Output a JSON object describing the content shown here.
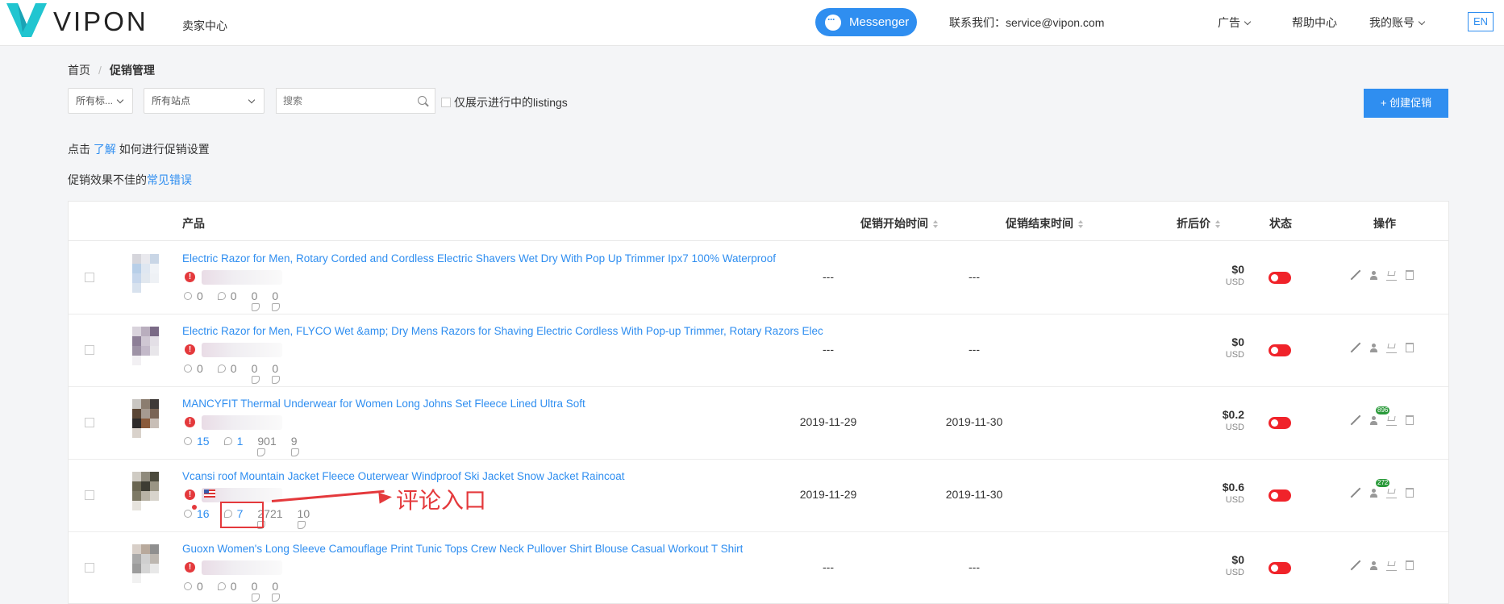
{
  "header": {
    "brand": "VIPON",
    "brand_sub": "卖家中心",
    "messenger_label": "Messenger",
    "contact": "联系我们：service@vipon.com",
    "nav": [
      "广告",
      "帮助中心",
      "我的账号"
    ],
    "lang": "EN",
    "colors": {
      "accent": "#2f8ef0",
      "logo": "#21c5d0"
    }
  },
  "breadcrumb": {
    "home": "首页",
    "current": "促销管理"
  },
  "filters": {
    "all_tags": "所有标...",
    "all_sites": "所有站点",
    "search_placeholder": "搜索",
    "only_active_label": "仅展示进行中的listings",
    "create_button": "+ 创建促销"
  },
  "tips": {
    "line1_prefix": "点击",
    "line1_link": "了解",
    "line1_suffix": "如何进行促销设置",
    "line2_prefix": "促销效果不佳的",
    "line2_link": "常见错误"
  },
  "table": {
    "headers": {
      "product": "产品",
      "start": "促销开始时间",
      "end": "促销结束时间",
      "price": "折后价",
      "status": "状态",
      "actions": "操作"
    },
    "rows": [
      {
        "title": "Electric Razor for Men, Rotary Corded and Cordless Electric Shavers Wet Dry With Pop Up Trimmer Ipx7 100% Waterproof",
        "s1": "0",
        "s2": "0",
        "s3": "0",
        "s4": "0",
        "start": "---",
        "end": "---",
        "price": "$0",
        "currency": "USD",
        "badge": ""
      },
      {
        "title": "Electric Razor for Men, FLYCO Wet &amp; Dry Mens Razors for Shaving Electric Cordless With Pop-up Trimmer, Rotary Razors Elec",
        "s1": "0",
        "s2": "0",
        "s3": "0",
        "s4": "0",
        "start": "---",
        "end": "---",
        "price": "$0",
        "currency": "USD",
        "badge": ""
      },
      {
        "title": "MANCYFIT Thermal Underwear for Women Long Johns Set Fleece Lined Ultra Soft",
        "s1": "15",
        "s2": "1",
        "s3": "901",
        "s4": "9",
        "start": "2019-11-29",
        "end": "2019-11-30",
        "price": "$0.2",
        "currency": "USD",
        "badge": "896"
      },
      {
        "title": "Vcansi                    roof Mountain Jacket Fleece Outerwear Windproof Ski Jacket Snow Jacket Raincoat",
        "s1": "16",
        "s2": "7",
        "s3": "2721",
        "s4": "10",
        "start": "2019-11-29",
        "end": "2019-11-30",
        "price": "$0.6",
        "currency": "USD",
        "badge": "272"
      },
      {
        "title": "Guoxn Women's Long Sleeve Camouflage Print Tunic Tops Crew Neck Pullover Shirt Blouse Casual Workout T Shirt",
        "s1": "0",
        "s2": "0",
        "s3": "0",
        "s4": "0",
        "start": "---",
        "end": "---",
        "price": "$0",
        "currency": "USD",
        "badge": ""
      }
    ]
  },
  "annotation": {
    "label": "评论入口",
    "color": "#e4393c"
  }
}
